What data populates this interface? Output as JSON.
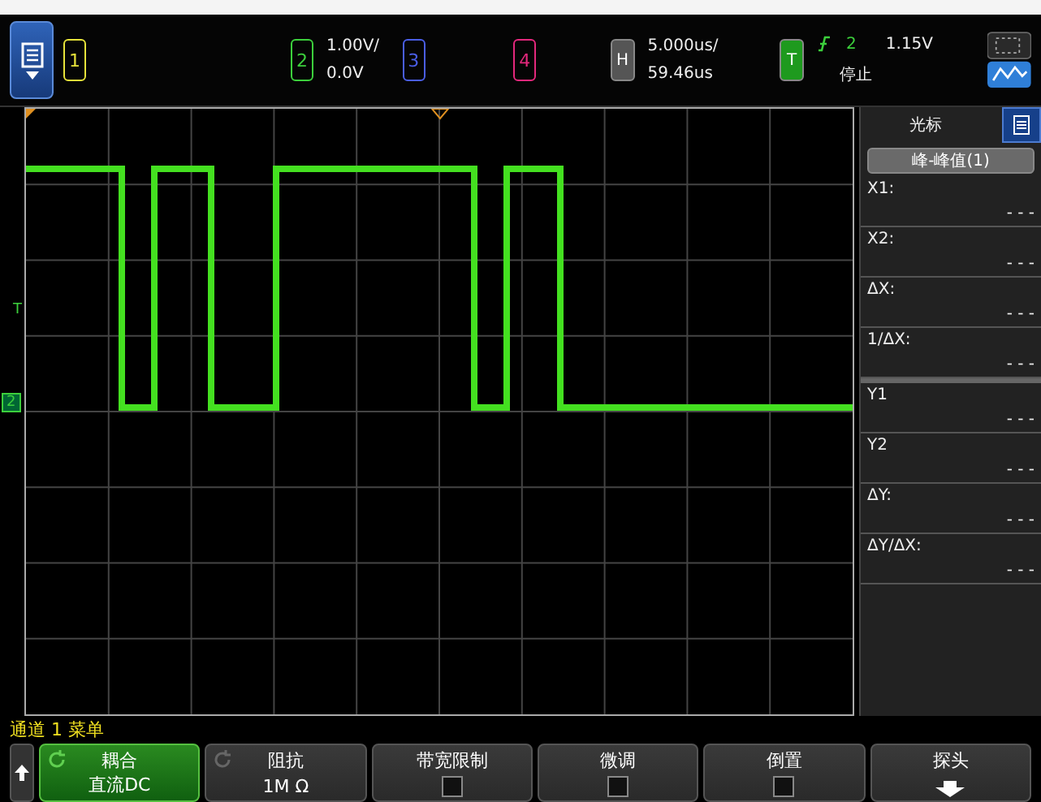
{
  "toolbar": {
    "channels": [
      {
        "label": "1",
        "color": "#e6e23a"
      },
      {
        "label": "2",
        "color": "#3ccf3c",
        "scale": "1.00V/",
        "offset": "0.0V"
      },
      {
        "label": "3",
        "color": "#4a5ee6"
      },
      {
        "label": "4",
        "color": "#e3287c"
      }
    ],
    "horizontal": {
      "label": "H",
      "scale": "5.000us/",
      "delay": "59.46us"
    },
    "trigger": {
      "label": "T",
      "source": "2",
      "level": "1.15V",
      "status": "停止"
    }
  },
  "plot": {
    "trigger_marker": "T",
    "ground_marker": "2"
  },
  "cursor_panel": {
    "title": "光标",
    "mode": "峰-峰值(1)",
    "groups": [
      [
        {
          "label": "X1:",
          "value": "- - -"
        },
        {
          "label": "X2:",
          "value": "- - -"
        },
        {
          "label": "ΔX:",
          "value": "- - -"
        },
        {
          "label": "1/ΔX:",
          "value": "- - -"
        }
      ],
      [
        {
          "label": "Y1",
          "value": "- - -"
        },
        {
          "label": "Y2",
          "value": "- - -"
        },
        {
          "label": "ΔY:",
          "value": "- - -"
        },
        {
          "label": "ΔY/ΔX:",
          "value": "- - -"
        }
      ]
    ]
  },
  "menu_title": "通道 1 菜单",
  "softkeys": [
    {
      "kind": "value",
      "label": "耦合",
      "value": "直流DC",
      "selected": true
    },
    {
      "kind": "value",
      "label": "阻抗",
      "value": "1M Ω",
      "selected": false
    },
    {
      "kind": "checkbox",
      "label": "带宽限制",
      "checked": false
    },
    {
      "kind": "checkbox",
      "label": "微调",
      "checked": false
    },
    {
      "kind": "checkbox",
      "label": "倒置",
      "checked": false
    },
    {
      "kind": "submenu",
      "label": "探头"
    }
  ]
}
